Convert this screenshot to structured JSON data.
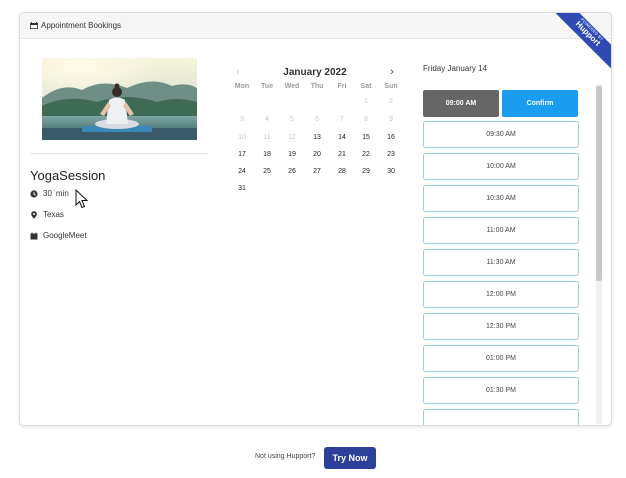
{
  "header": {
    "title": "Appointment Bookings",
    "icon": "calendar-icon"
  },
  "ribbon": {
    "small_text": "POWERED BY",
    "brand": "Hupport",
    "color": "#2f4bb3"
  },
  "event": {
    "title": "YogaSession",
    "duration_value": "30",
    "duration_unit": "min",
    "location": "Texas",
    "platform": "GoogleMeet"
  },
  "calendar": {
    "month_label": "January 2022",
    "prev_icon": "chevron-left-icon",
    "next_icon": "chevron-right-icon",
    "weekdays": [
      "Mon",
      "Tue",
      "Wed",
      "Thu",
      "Fri",
      "Sat",
      "Sun"
    ],
    "weeks": [
      [
        {
          "d": "",
          "off": true
        },
        {
          "d": "",
          "off": true
        },
        {
          "d": "",
          "off": true
        },
        {
          "d": "",
          "off": true
        },
        {
          "d": "",
          "off": true
        },
        {
          "d": "1",
          "off": true
        },
        {
          "d": "2",
          "off": true
        }
      ],
      [
        {
          "d": "3",
          "off": true
        },
        {
          "d": "4",
          "off": true
        },
        {
          "d": "5",
          "off": true
        },
        {
          "d": "6",
          "off": true
        },
        {
          "d": "7",
          "off": true
        },
        {
          "d": "8",
          "off": true
        },
        {
          "d": "9",
          "off": true
        }
      ],
      [
        {
          "d": "10",
          "off": true
        },
        {
          "d": "11",
          "off": true
        },
        {
          "d": "12",
          "off": true
        },
        {
          "d": "13",
          "off": false
        },
        {
          "d": "14",
          "off": false
        },
        {
          "d": "15",
          "off": false
        },
        {
          "d": "16",
          "off": false
        }
      ],
      [
        {
          "d": "17",
          "off": false
        },
        {
          "d": "18",
          "off": false
        },
        {
          "d": "19",
          "off": false
        },
        {
          "d": "20",
          "off": false
        },
        {
          "d": "21",
          "off": false
        },
        {
          "d": "22",
          "off": false
        },
        {
          "d": "23",
          "off": false
        }
      ],
      [
        {
          "d": "24",
          "off": false
        },
        {
          "d": "25",
          "off": false
        },
        {
          "d": "26",
          "off": false
        },
        {
          "d": "27",
          "off": false
        },
        {
          "d": "28",
          "off": false
        },
        {
          "d": "29",
          "off": false
        },
        {
          "d": "30",
          "off": false
        }
      ],
      [
        {
          "d": "31",
          "off": false
        },
        {
          "d": "",
          "off": true
        },
        {
          "d": "",
          "off": true
        },
        {
          "d": "",
          "off": true
        },
        {
          "d": "",
          "off": true
        },
        {
          "d": "",
          "off": true
        },
        {
          "d": "",
          "off": true
        }
      ]
    ]
  },
  "slots": {
    "date_label": "Friday January 14",
    "selected": "09:00 AM",
    "confirm_label": "Confirm",
    "times": [
      "09:30 AM",
      "10:00 AM",
      "10:30 AM",
      "11:00 AM",
      "11:30 AM",
      "12:00 PM",
      "12:30 PM",
      "01:00 PM",
      "01:30 PM"
    ],
    "accent_color": "#1a9cf0"
  },
  "footer": {
    "prompt": "Not using Hupport?",
    "button_label": "Try Now",
    "button_color": "#2c3f99"
  }
}
